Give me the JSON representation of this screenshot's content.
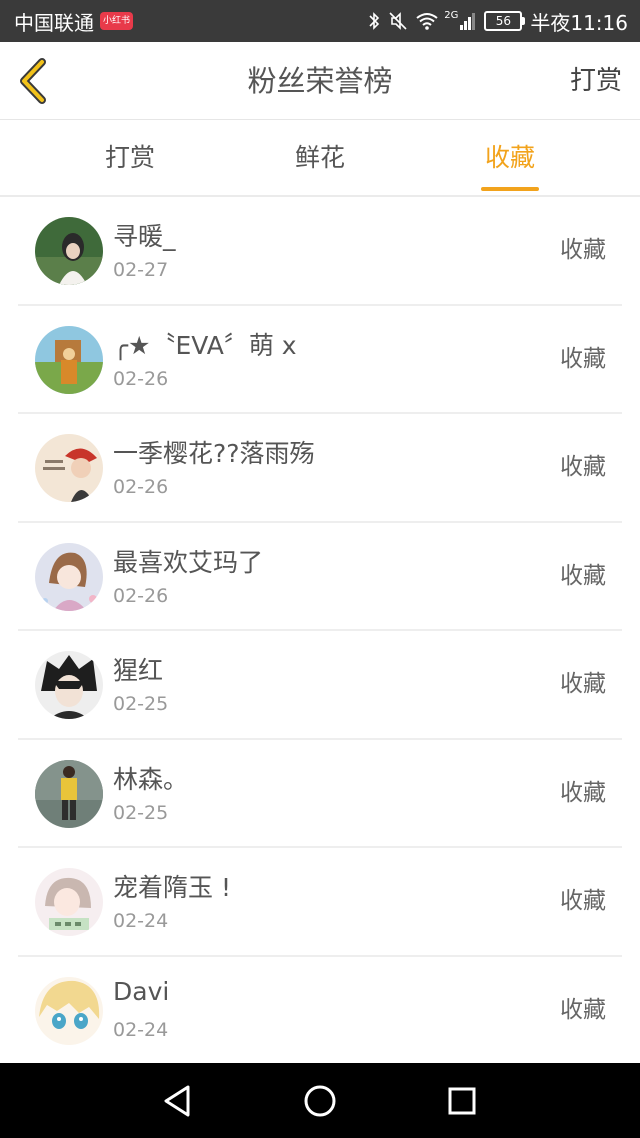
{
  "status_bar": {
    "carrier": "中国联通",
    "carrier_badge": "小红书",
    "network": "2G",
    "battery": "56",
    "time": "半夜11:16"
  },
  "header": {
    "title": "粉丝荣誉榜",
    "action_label": "打赏",
    "back_icon": "chevron-left-icon"
  },
  "tabs": [
    {
      "label": "打赏",
      "active": false
    },
    {
      "label": "鲜花",
      "active": false
    },
    {
      "label": "收藏",
      "active": true
    }
  ],
  "colors": {
    "accent": "#f2a31c",
    "status_bar": "#3a3a3a",
    "nav_bar": "#000000"
  },
  "fans": [
    {
      "name": "寻暖_",
      "date": "02-27",
      "action": "收藏"
    },
    {
      "name": "╭★〝EVA〞萌 x",
      "date": "02-26",
      "action": "收藏"
    },
    {
      "name": "一季樱花??落雨殇",
      "date": "02-26",
      "action": "收藏"
    },
    {
      "name": "最喜欢艾玛了",
      "date": "02-26",
      "action": "收藏"
    },
    {
      "name": "猩红",
      "date": "02-25",
      "action": "收藏"
    },
    {
      "name": "林森。",
      "date": "02-25",
      "action": "收藏"
    },
    {
      "name": "宠着隋玉 !",
      "date": "02-24",
      "action": "收藏"
    },
    {
      "name": "Davi",
      "date": "02-24",
      "action": "收藏"
    }
  ],
  "nav": {
    "back_icon": "triangle-back-icon",
    "home_icon": "circle-home-icon",
    "recents_icon": "square-recents-icon"
  }
}
